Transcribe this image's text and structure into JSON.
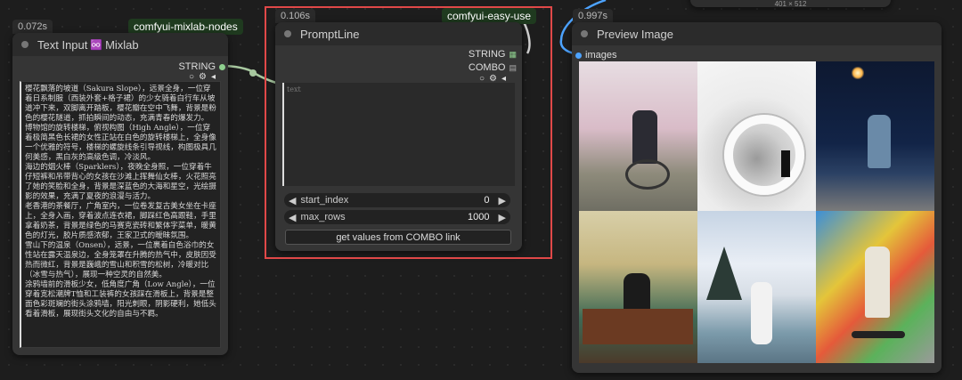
{
  "top_size_label": "401 × 512",
  "node_text": {
    "time": "0.072s",
    "pack": "comfyui-mixlab-nodes",
    "title_prefix": "Text Input",
    "title_badge": "♾️",
    "title_suffix": "Mixlab",
    "output": "STRING",
    "text": "樱花飘落的坡道（Sakura Slope），远景全身，一位穿着日系制服（西装外套+格子裙）的少女骑着白行车从坡道冲下来，双脚离开踏板，樱花瓣在空中飞舞，背景是粉色的樱花隧道，抓拍瞬间的动态，充满青春的爆发力。\n博物馆的旋转楼梯，俯视构图（High Angle），一位穿着极简黑色长裙的女性正站在白色的旋转楼梯上，全身像一个优雅的符号，楼梯的螺旋线条引导视线，构图极具几何美感，黑白灰的高级色调，冷淡风。\n海边的烟火棒（Sparklers），夜晚全身照，一位穿着牛仔短裤和吊带背心的女孩在沙滩上挥舞仙女棒，火花照亮了她的笑脸和全身，背景是深蓝色的大海和星空，光绘摄影的效果，充满了夏夜的浪漫与活力。\n老香港的茶餐厅，广角室内，一位卷发复古美女坐在卡座上，全身入画，穿着波点连衣裙，脚踩红色高跟鞋，手里拿着奶茶，背景是绿色的马赛克瓷砖和繁体字菜单，暖黄色的灯光，胶片质感浓郁，王家卫式的暧昧氛围。\n雪山下的温泉（Onsen），远景，一位裹着白色浴巾的女性站在露天温泉边，全身笼罩在升腾的热气中，皮肤因受热而微红，背景是巍峨的雪山和积雪的松树，冷暖对比（冰雪与热气），展现一种空灵的自然美。\n涂鸦墙前的滑板少女，低角度广角（Low Angle），一位穿着宽松潮牌T恤和工装裤的女孩踩在滑板上，背景是整面色彩斑斓的街头涂鸦墙，阳光刺眼，阴影硬利，她低头看着滑板，展现街头文化的自由与不羁。"
  },
  "node_prompt": {
    "time": "0.106s",
    "pack": "comfyui-easy-use",
    "title": "PromptLine",
    "output1": "STRING",
    "output2": "COMBO",
    "placeholder": "text",
    "start_label": "start_index",
    "start_value": "0",
    "max_label": "max_rows",
    "max_value": "1000",
    "button": "get values from COMBO link"
  },
  "node_preview": {
    "time": "0.997s",
    "title": "Preview Image",
    "input": "images"
  },
  "colors": {
    "accent_green": "#8fd08f",
    "selection_red": "#e04848",
    "link_blue": "#4da3ff"
  }
}
